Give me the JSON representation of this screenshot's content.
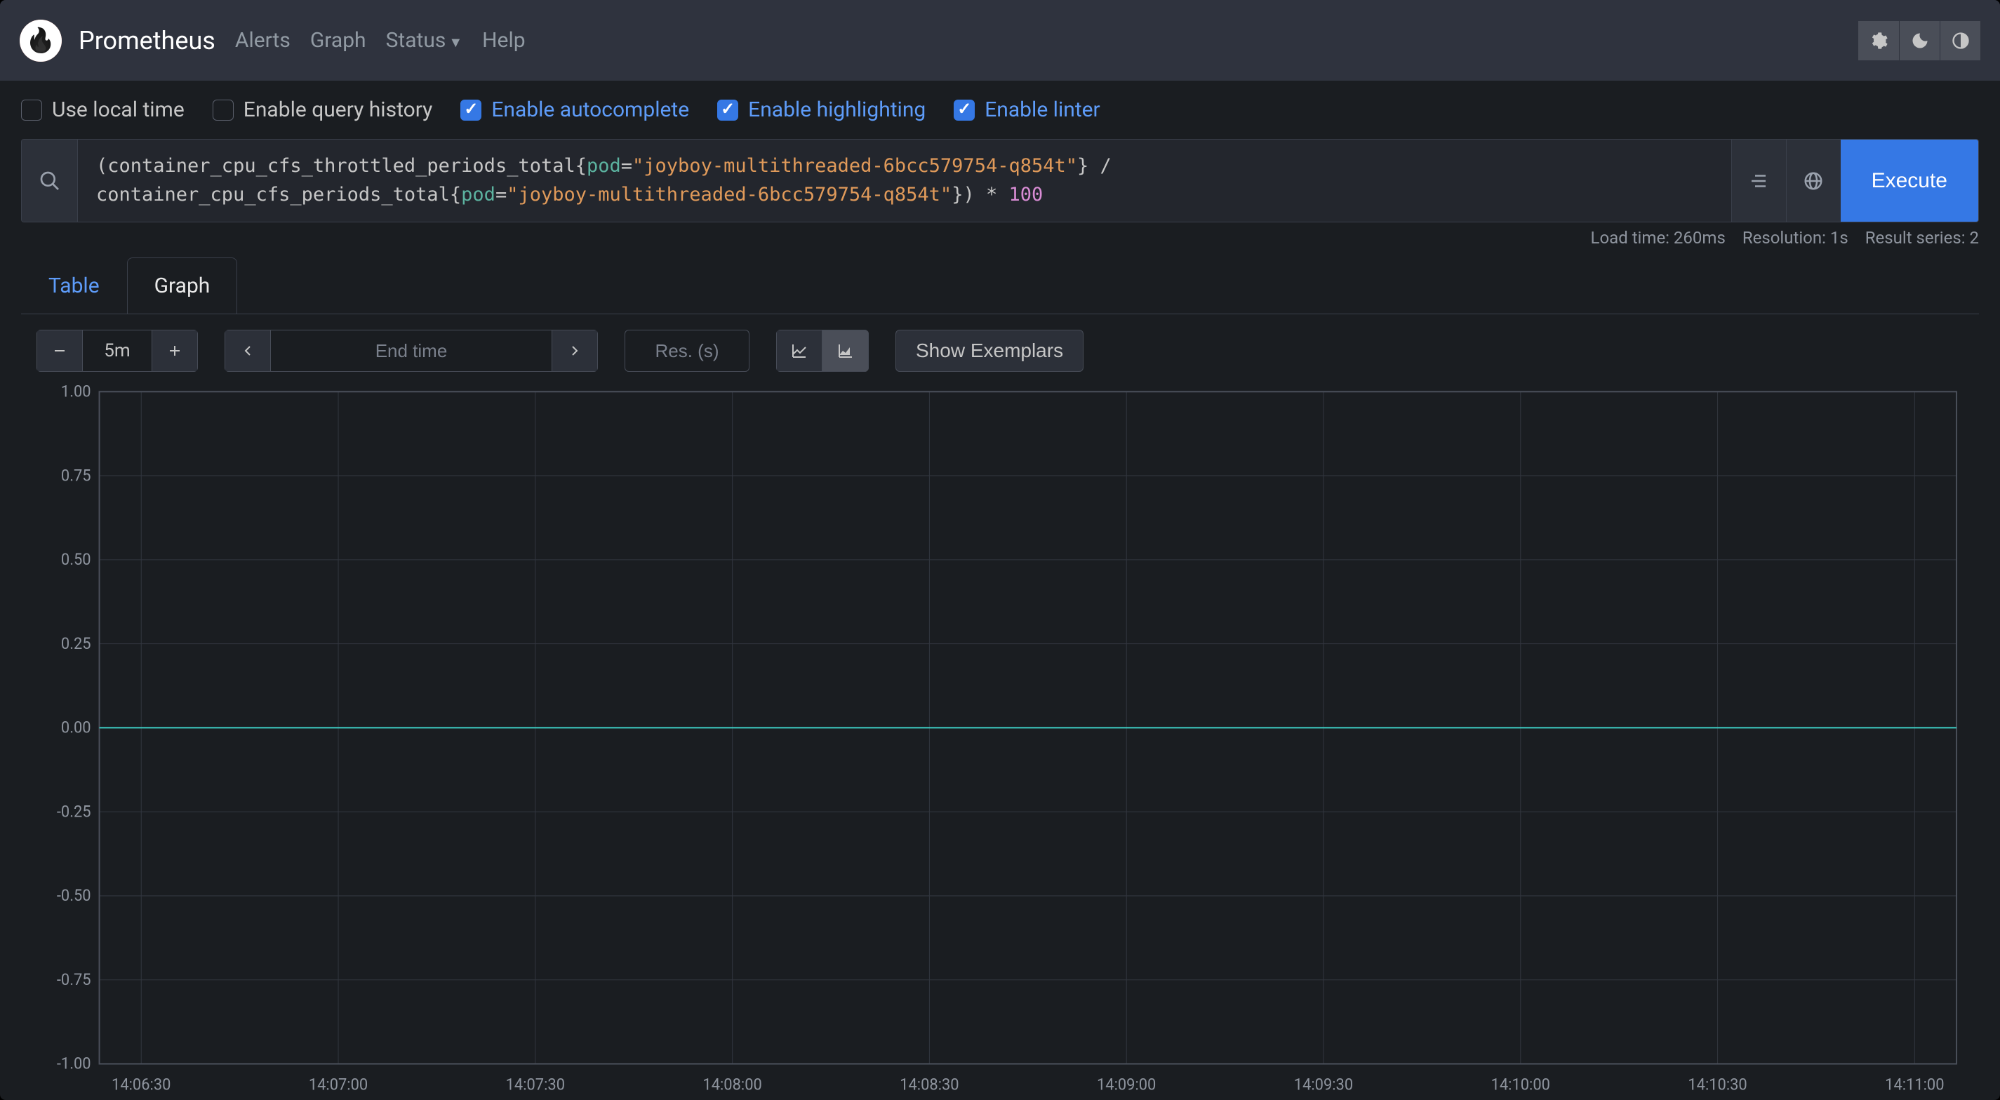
{
  "brand": "Prometheus",
  "nav": {
    "alerts": "Alerts",
    "graph": "Graph",
    "status": "Status",
    "help": "Help"
  },
  "options": {
    "local_time": {
      "label": "Use local time",
      "checked": false
    },
    "query_history": {
      "label": "Enable query history",
      "checked": false
    },
    "autocomplete": {
      "label": "Enable autocomplete",
      "checked": true
    },
    "highlighting": {
      "label": "Enable highlighting",
      "checked": true
    },
    "linter": {
      "label": "Enable linter",
      "checked": true
    }
  },
  "query": {
    "line1_pre": "(container_cpu_cfs_throttled_periods_total{",
    "line1_label": "pod",
    "line1_eq": "=",
    "line1_str": "\"joyboy-multithreaded-6bcc579754-q854t\"",
    "line1_post": "} /",
    "line2_pre": "container_cpu_cfs_periods_total{",
    "line2_label": "pod",
    "line2_eq": "=",
    "line2_str": "\"joyboy-multithreaded-6bcc579754-q854t\"",
    "line2_post": "}) * ",
    "line2_num": "100"
  },
  "execute": "Execute",
  "status": {
    "load": "Load time: 260ms",
    "resolution": "Resolution: 1s",
    "series": "Result series: 2"
  },
  "tabs": {
    "table": "Table",
    "graph": "Graph"
  },
  "toolbar": {
    "range": "5m",
    "endtime_placeholder": "End time",
    "res_placeholder": "Res. (s)",
    "exemplars": "Show Exemplars"
  },
  "chart_data": {
    "type": "line",
    "title": "",
    "xlabel": "",
    "ylabel": "",
    "ylim": [
      -1.0,
      1.0
    ],
    "y_ticks": [
      1.0,
      0.75,
      0.5,
      0.25,
      0.0,
      -0.25,
      -0.5,
      -0.75,
      -1.0
    ],
    "y_tick_labels": [
      "1.00",
      "0.75",
      "0.50",
      "0.25",
      "0.00",
      "-0.25",
      "-0.50",
      "-0.75",
      "-1.00"
    ],
    "x_tick_labels": [
      "14:06:30",
      "14:07:00",
      "14:07:30",
      "14:08:00",
      "14:08:30",
      "14:09:00",
      "14:09:30",
      "14:10:00",
      "14:10:30",
      "14:11:00"
    ],
    "series": [
      {
        "name": "result",
        "values": [
          0,
          0,
          0,
          0,
          0,
          0,
          0,
          0,
          0,
          0
        ]
      }
    ]
  }
}
